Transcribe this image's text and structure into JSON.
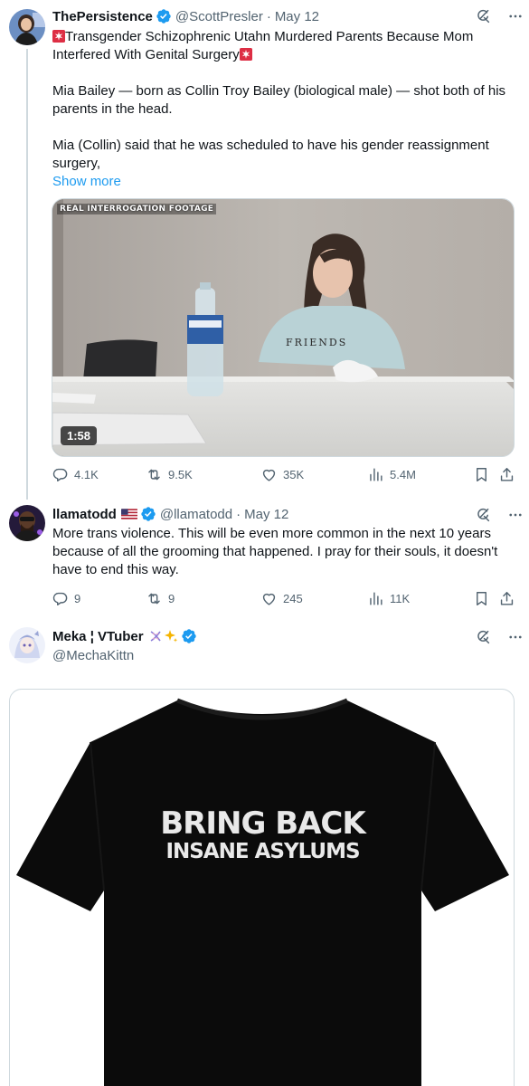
{
  "tweets": [
    {
      "name": "ThePersistence",
      "handle": "@ScottPresler",
      "dot": "·",
      "date": "May 12",
      "text": {
        "line1": "Transgender Schizophrenic Utahn Murdered Parents Because Mom",
        "line2": "Interfered With Genital Surgery",
        "para2_line1": "Mia Bailey — born as Collin Troy Bailey (biological male) — shot both of his",
        "para2_line2": "parents in the head.",
        "para3_line1": "Mia (Collin) said that he was scheduled to have his gender reassignment",
        "para3_line2": "surgery,"
      },
      "show_more": "Show more",
      "video": {
        "label": "REAL INTERROGATION FOOTAGE",
        "duration": "1:58",
        "shirt_text": "FRIENDS"
      },
      "stats": {
        "replies": "4.1K",
        "reposts": "9.5K",
        "likes": "35K",
        "views": "5.4M"
      }
    },
    {
      "name": "llamatodd",
      "handle": "@llamatodd",
      "dot": "·",
      "date": "May 12",
      "text": {
        "line1": "More trans violence. This will be even more common in the next 10 years",
        "line2": "because of all the grooming that happened. I pray for their souls, it doesn't",
        "line3": "have to end this way."
      },
      "stats": {
        "replies": "9",
        "reposts": "9",
        "likes": "245",
        "views": "11K"
      }
    },
    {
      "name": "Meka ¦ VTuber",
      "handle": "@MechaKittn",
      "image": {
        "line1": "BRING BACK",
        "line2": "INSANE ASYLUMS"
      }
    }
  ],
  "colors": {
    "text": "#0f1419",
    "secondary": "#536471",
    "link": "#1d9bf0",
    "verified": "#1d9bf0",
    "divider": "#cfd9de"
  },
  "icons": [
    "verified-badge-icon",
    "grok-icon",
    "more-icon",
    "reply-icon",
    "repost-icon",
    "like-icon",
    "views-icon",
    "bookmark-icon",
    "share-icon",
    "siren-icon",
    "usa-flag-icon",
    "dna-icon",
    "sparkles-icon"
  ]
}
